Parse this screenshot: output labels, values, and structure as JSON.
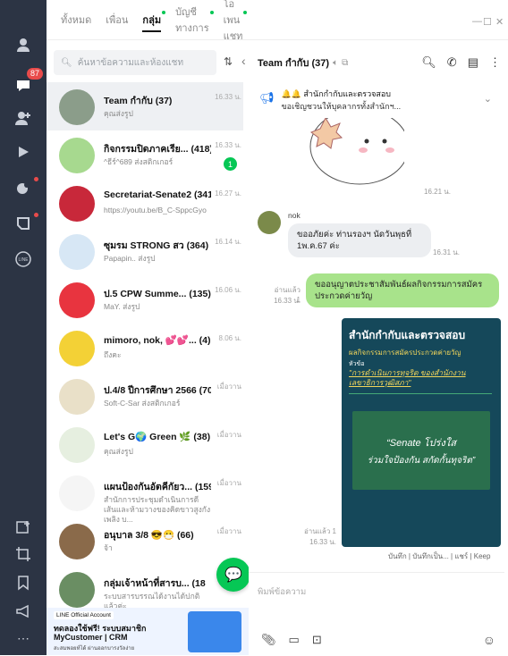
{
  "rail": {
    "badge": "87"
  },
  "tabs": [
    {
      "label": "ทั้งหมด",
      "active": false,
      "dot": false
    },
    {
      "label": "เพื่อน",
      "active": false,
      "dot": false
    },
    {
      "label": "กลุ่ม",
      "active": true,
      "dot": true
    },
    {
      "label": "บัญชีทางการ",
      "active": false,
      "dot": true
    },
    {
      "label": "โอเพนแชท",
      "active": false,
      "dot": true
    }
  ],
  "search": {
    "placeholder": "ค้นหาข้อความและห้องแชท"
  },
  "chats": [
    {
      "name": "Team กำกับ (37)",
      "sub": "คุณส่งรูป",
      "time": "16.33 น.",
      "unread": "",
      "avatar": "#8b9d8a"
    },
    {
      "name": "กิจกรรมปิดภาคเรีย... (418)",
      "sub": "^ธีร์^689 ส่งสติกเกอร์",
      "time": "16.33 น.",
      "unread": "1",
      "avatar": "#a7d98f"
    },
    {
      "name": "Secretariat-Senate2 (341)",
      "sub": "https://youtu.be/B_C-SppcGyo",
      "time": "16.27 น.",
      "unread": "",
      "avatar": "#c8283a"
    },
    {
      "name": "ซุมรม STRONG สว (364)",
      "sub": "Papapin.. ส่งรูป",
      "time": "16.14 น.",
      "unread": "",
      "avatar": "#d7e7f5"
    },
    {
      "name": "ป.5 CPW Summe... (135)",
      "sub": "MaY. ส่งรูป",
      "time": "16.06 น.",
      "unread": "",
      "avatar": "#e8343f"
    },
    {
      "name": "mimoro, nok, 💕💕... (4)",
      "sub": "ถึงคะ",
      "time": "8.06 น.",
      "unread": "",
      "avatar": "#f3d136"
    },
    {
      "name": "ป.4/8 ปีการศึกษา 2566 (70)",
      "sub": "Soft-C-Sar ส่งสติกเกอร์",
      "time": "เมื่อวาน",
      "unread": "",
      "avatar": "#e9e0c8"
    },
    {
      "name": "Let's G🌍 Green 🌿 (38)",
      "sub": "คุณส่งรูป",
      "time": "เมื่อวาน",
      "unread": "",
      "avatar": "#e6efe0"
    },
    {
      "name": "แผนป้องกันอัตคีกัยว... (159)",
      "sub": "สำนักการประชุมดำเนินการดีเส้นและห้ามวางของคิดขาวสูงกังเพลิง บ...",
      "time": "เมื่อวาน",
      "unread": "",
      "avatar": "#f5f5f5"
    },
    {
      "name": "อนุบาล 3/8 😎😷 (66)",
      "sub": "จ้า",
      "time": "เมื่อวาน",
      "unread": "",
      "avatar": "#8a6a4a"
    },
    {
      "name": "กลุ่มเจ้าหน้าที่สารบ... (18",
      "sub": "ระบบสารบรรณได้งานได้ปกติแล้วค่ะ",
      "time": "",
      "unread": "",
      "avatar": "#6a8e63"
    }
  ],
  "ad": {
    "tag": "LINE Official Account",
    "line1": "ทดลองใช้ฟรี! ระบบสมาชิก",
    "line2": "MyCustomer | CRM",
    "line3": "สะสมพอยท์ได้ ผ่านออกบารงวัลง่าย"
  },
  "chat": {
    "title": "Team กำกับ (37)",
    "announcement": {
      "line1": "🔔🔔 สำนักกำกับและตรวจสอบ",
      "line2": "ขอเชิญชวนให้บุคลากรทั้งสำนักฯ..."
    },
    "sticker_time": "16.21 น.",
    "sender": "nok",
    "msg_in": "ขออภัยค่ะ ท่านรองฯ นัดวันพุธที่ 1พ.ค.67 ค่ะ",
    "msg_in_time": "16.31 น.",
    "msg_out": "ขออนุญาตประชาสัมพันธ์ผลกิจกรรมการสมัครประกวดค่ายวัญ",
    "msg_out_read": "อ่านแล้ว 1",
    "msg_out_time": "16.33 น.",
    "poster": {
      "heading": "สำนักกำกับและตรวจสอบ",
      "subheading": "ผลกิจกรรมการสมัครประกวดค่ายวัญ",
      "topic_label": "หัวข้อ",
      "topic": "\"การดำเนินการทุจริต ของสำนักงานเลขาธิการวุฒิสภา\"",
      "slogan1": "“Senate โปร่งใส",
      "slogan2": "ร่วมใจป้องกัน สกัดกั้นทุจริต”"
    },
    "poster_read": "อ่านแล้ว 1",
    "poster_time": "16.33 น.",
    "actions": "บันทึก | บันทึกเป็น... | แชร์ | Keep",
    "input_placeholder": "พิมพ์ข้อความ"
  }
}
